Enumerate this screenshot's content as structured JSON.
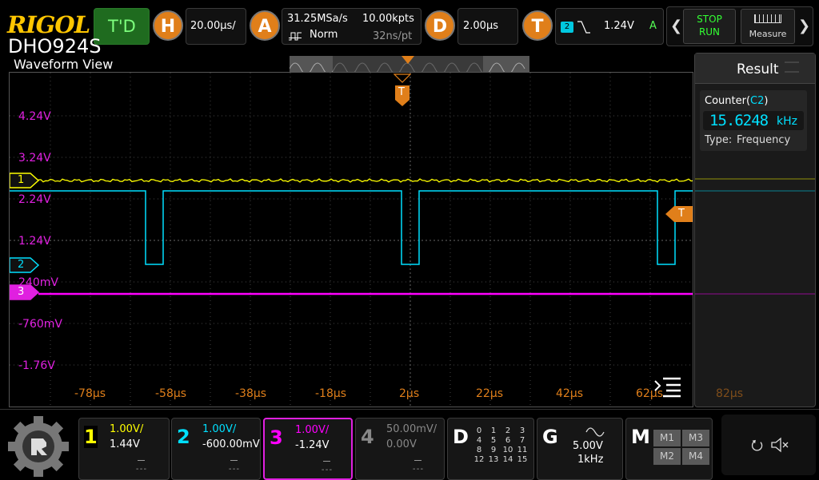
{
  "brand": {
    "logo": "RIGOL",
    "model": "DHO924S"
  },
  "topbar": {
    "status": "T'D",
    "horizontal": {
      "icon_letter": "H",
      "timebase": "20.00μs/"
    },
    "acquire": {
      "icon_letter": "A",
      "sample_rate": "31.25MSa/s",
      "mode": "Norm",
      "points": "10.00kpts",
      "resolution": "32ns/pt"
    },
    "delay": {
      "icon_letter": "D",
      "value": "2.00μs"
    },
    "trigger": {
      "icon_letter": "T",
      "source": "2",
      "level": "1.24V",
      "sweep": "A"
    },
    "stop_label": "STOP",
    "run_label": "RUN",
    "measure_label": "Measure"
  },
  "waveform_view": {
    "title": "Waveform View",
    "y_labels": [
      "4.24V",
      "3.24V",
      "2.24V",
      "1.24V",
      "240mV",
      "-760mV",
      "-1.76V"
    ],
    "x_labels": [
      "-78μs",
      "-58μs",
      "-38μs",
      "-18μs",
      "2μs",
      "22μs",
      "42μs",
      "62μs",
      "82μs"
    ],
    "trigger_marker": "T",
    "channel_markers": [
      "1",
      "2",
      "3"
    ]
  },
  "result": {
    "title": "Result",
    "counter_label": "Counter(",
    "counter_channel": "C2",
    "counter_close": ")",
    "value": "15.6248",
    "unit": "kHz",
    "type_label": "Type:",
    "type_value": "Frequency"
  },
  "channels": [
    {
      "num": "1",
      "scale": "1.00V/",
      "offset": "1.44V",
      "color": "#ffff00"
    },
    {
      "num": "2",
      "scale": "1.00V/",
      "offset": "-600.00mV",
      "color": "#00e0ff"
    },
    {
      "num": "3",
      "scale": "1.00V/",
      "offset": "-1.24V",
      "color": "#ff00ff"
    },
    {
      "num": "4",
      "scale": "50.00mV/",
      "offset": "0.00V",
      "color": "#888888"
    }
  ],
  "digital": {
    "letter": "D",
    "channels": [
      "0",
      "1",
      "2",
      "3",
      "4",
      "5",
      "6",
      "7",
      "8",
      "9",
      "10",
      "11",
      "12",
      "13",
      "14",
      "15"
    ]
  },
  "generator": {
    "letter": "G",
    "amplitude": "5.00V",
    "frequency": "1kHz"
  },
  "math": {
    "letter": "M",
    "items": [
      "M1",
      "M3",
      "M2",
      "M4"
    ]
  },
  "colors": {
    "accent": "#e07f1a",
    "ch1": "#ffff00",
    "ch2": "#00e0ff",
    "ch3": "#ff00ff",
    "stop": "#22dd22"
  }
}
